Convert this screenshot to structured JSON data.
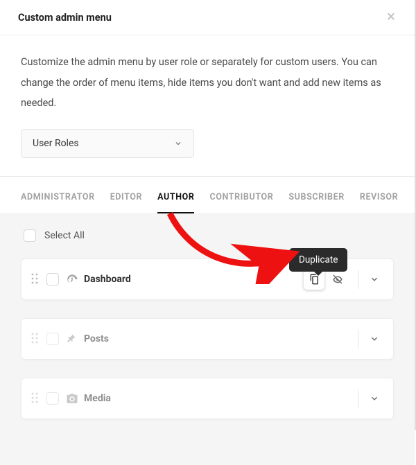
{
  "header": {
    "title": "Custom admin menu"
  },
  "description": "Customize the admin menu by user role or separately for custom users. You can change the order of menu items, hide items you don't want and add new items as needed.",
  "scope_select": {
    "value": "User Roles"
  },
  "tabs": [
    "ADMINISTRATOR",
    "EDITOR",
    "AUTHOR",
    "CONTRIBUTOR",
    "SUBSCRIBER",
    "REVISOR"
  ],
  "active_tab_index": 2,
  "select_all_label": "Select All",
  "tooltip_text": "Duplicate",
  "items": [
    {
      "label": "Dashboard"
    },
    {
      "label": "Posts"
    },
    {
      "label": "Media"
    }
  ]
}
